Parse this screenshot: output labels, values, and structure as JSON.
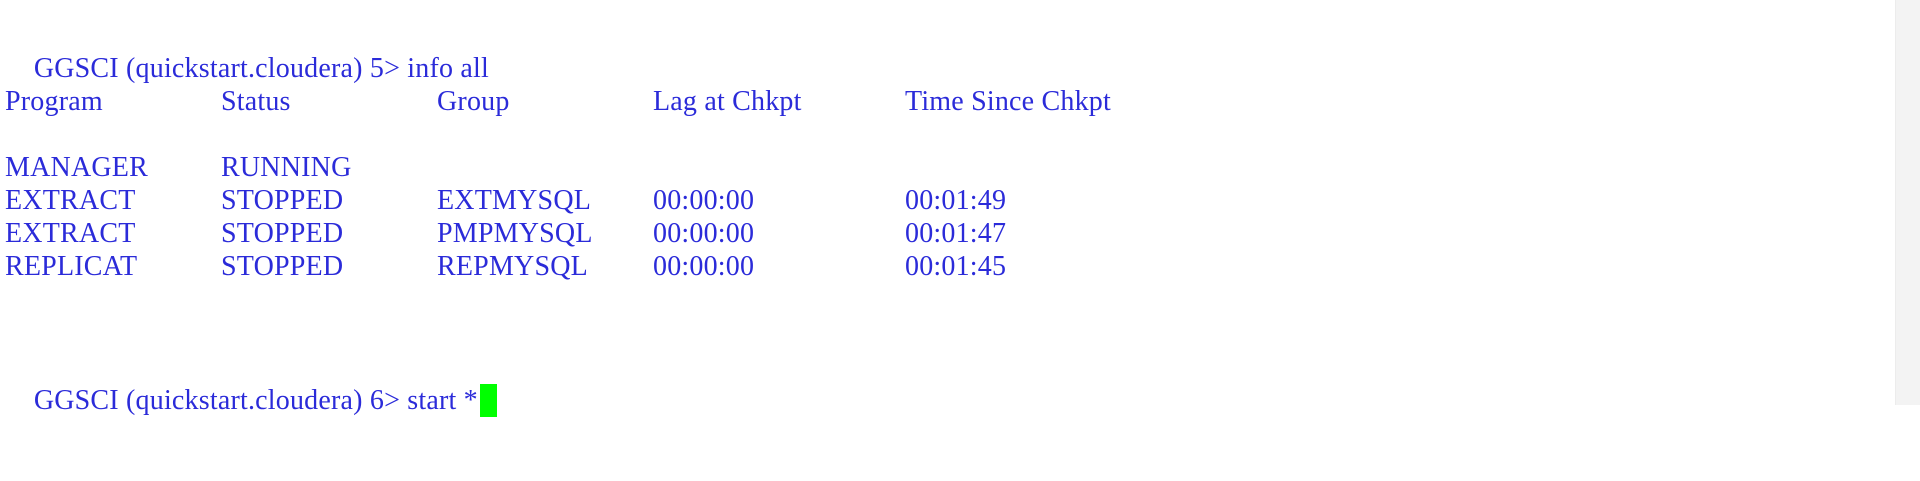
{
  "terminal": {
    "prompt1": "GGSCI (quickstart.cloudera) 5> info all",
    "headers": [
      "Program",
      "Status",
      "Group",
      "Lag at Chkpt",
      "Time Since Chkpt"
    ],
    "rows": [
      {
        "program": "MANAGER",
        "status": "RUNNING",
        "group": "",
        "lag": "",
        "since": ""
      },
      {
        "program": "EXTRACT",
        "status": "STOPPED",
        "group": "EXTMYSQL",
        "lag": "00:00:00",
        "since": "00:01:49"
      },
      {
        "program": "EXTRACT",
        "status": "STOPPED",
        "group": "PMPMYSQL",
        "lag": "00:00:00",
        "since": "00:01:47"
      },
      {
        "program": "REPLICAT",
        "status": "STOPPED",
        "group": "REPMYSQL",
        "lag": "00:00:00",
        "since": "00:01:45"
      }
    ],
    "prompt2": "GGSCI (quickstart.cloudera) 6> start *",
    "colors": {
      "text": "#2b2bd9",
      "cursor": "#00ff00",
      "background": "#ffffff"
    }
  }
}
